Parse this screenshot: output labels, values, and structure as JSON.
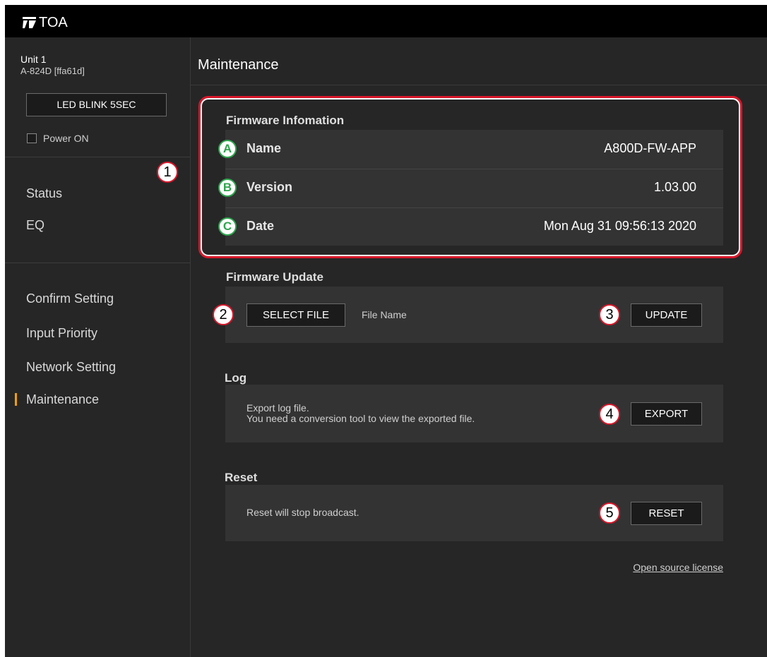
{
  "brand": {
    "name": "TOA",
    "icon": "toa-logo-icon"
  },
  "unit": {
    "title": "Unit 1",
    "model": "A-824D [ffa61d]",
    "led_button": "LED BLINK 5SEC",
    "power_label": "Power ON",
    "power_checked": false
  },
  "nav": {
    "group1": [
      "Status",
      "EQ"
    ],
    "group2": [
      "Confirm Setting",
      "Input Priority",
      "Network Setting",
      "Maintenance"
    ],
    "active": "Maintenance"
  },
  "main": {
    "title": "Maintenance"
  },
  "firmware_info": {
    "title": "Firmware Infomation",
    "rows": [
      {
        "marker": "A",
        "label": "Name",
        "value": "A800D-FW-APP"
      },
      {
        "marker": "B",
        "label": "Version",
        "value": "1.03.00"
      },
      {
        "marker": "C",
        "label": "Date",
        "value": "Mon Aug 31 09:56:13 2020"
      }
    ]
  },
  "firmware_update": {
    "title": "Firmware Update",
    "select_button": "SELECT FILE",
    "file_name": "File Name",
    "update_button": "UPDATE"
  },
  "log": {
    "title": "Log",
    "line1": "Export log file.",
    "line2": "You need a conversion tool to view the exported file.",
    "export_button": "EXPORT"
  },
  "reset": {
    "title": "Reset",
    "text": "Reset will stop broadcast.",
    "reset_button": "RESET"
  },
  "footer": {
    "license_link": "Open source license"
  },
  "callouts": [
    "1",
    "2",
    "3",
    "4",
    "5"
  ],
  "colors": {
    "accent": "#f0a000",
    "callout_red": "#d8182b",
    "marker_green": "#2ea54e",
    "panel_bg": "#333333",
    "app_bg": "#262626"
  }
}
